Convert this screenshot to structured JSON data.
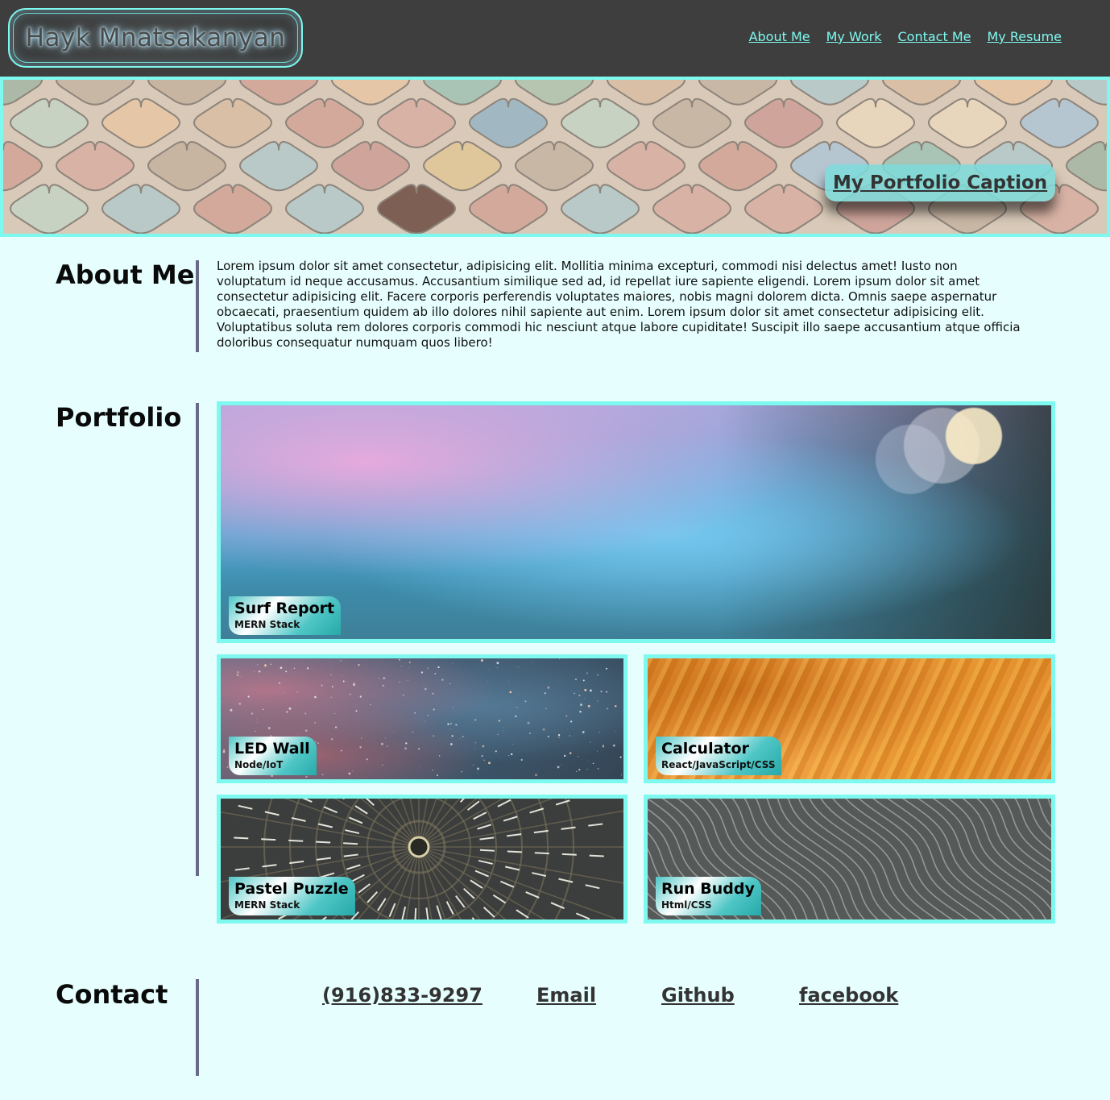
{
  "header": {
    "logo": "Hayk Mnatsakanyan",
    "nav": [
      "About Me",
      "My Work",
      "Contact Me",
      "My Resume"
    ]
  },
  "hero": {
    "caption": "My Portfolio Caption"
  },
  "about": {
    "title": "About Me",
    "text": "Lorem ipsum dolor sit amet consectetur, adipisicing elit. Mollitia minima excepturi, commodi nisi delectus amet! Iusto non voluptatum id neque accusamus. Accusantium similique sed ad, id repellat iure sapiente eligendi. Lorem ipsum dolor sit amet consectetur adipisicing elit. Facere corporis perferendis voluptates maiores, nobis magni dolorem dicta. Omnis saepe aspernatur obcaecati, praesentium quidem ab illo dolores nihil sapiente aut enim. Lorem ipsum dolor sit amet consectetur adipisicing elit. Voluptatibus soluta rem dolores corporis commodi hic nesciunt atque labore cupiditate! Suscipit illo saepe accusantium atque officia doloribus consequatur numquam quos libero!"
  },
  "portfolio": {
    "title": "Portfolio",
    "projects": [
      {
        "title": "Surf Report",
        "stack": "MERN Stack"
      },
      {
        "title": "LED Wall",
        "stack": "Node/IoT"
      },
      {
        "title": "Calculator",
        "stack": "React/JavaScript/CSS"
      },
      {
        "title": "Pastel Puzzle",
        "stack": "MERN Stack"
      },
      {
        "title": "Run Buddy",
        "stack": "Html/CSS"
      }
    ]
  },
  "contact": {
    "title": "Contact",
    "links": [
      "(916)833-9297",
      "Email",
      "Github",
      "facebook"
    ]
  },
  "colors": {
    "background": "#e6fffe",
    "header": "#3e3e3e",
    "accent": "#7df9ef",
    "rule": "#676a88"
  }
}
